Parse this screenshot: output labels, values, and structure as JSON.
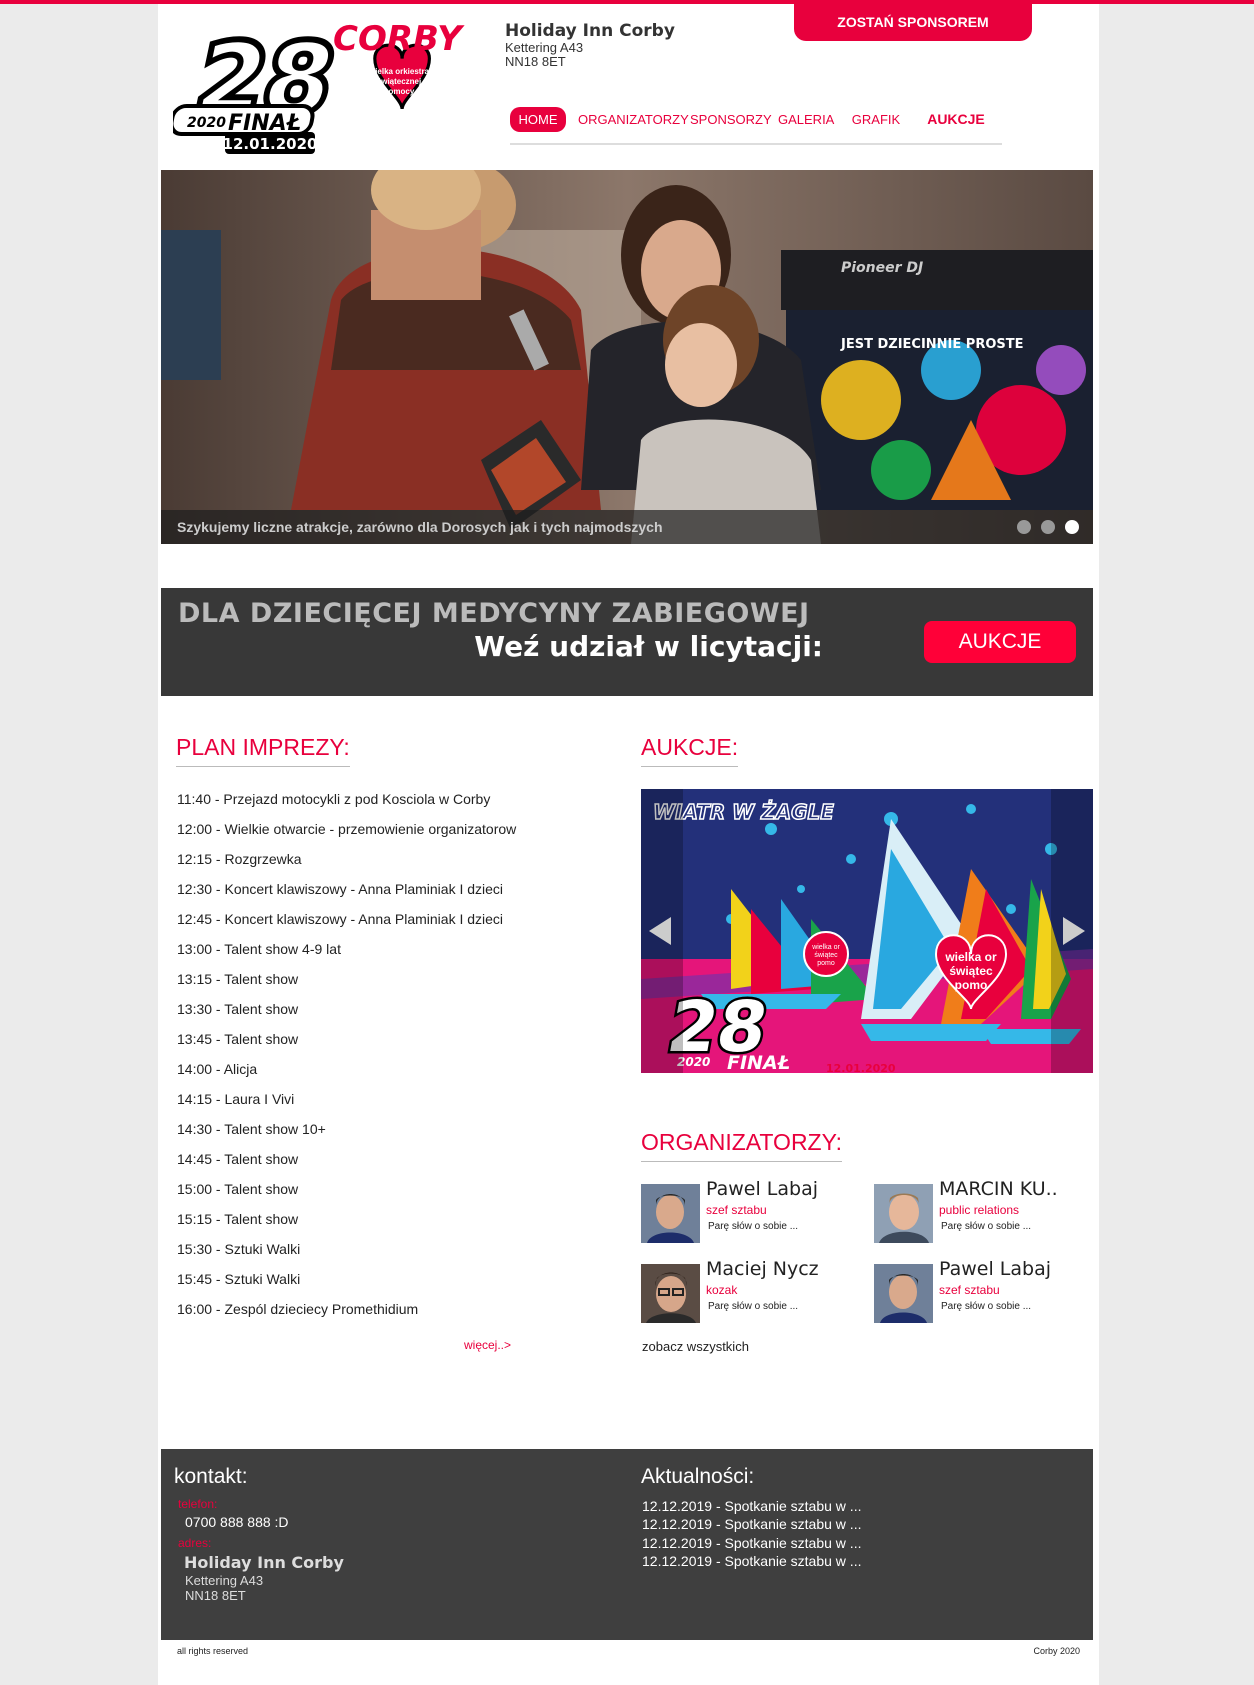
{
  "logo": {
    "number": "28",
    "city": "CORBY",
    "year": "2020",
    "final": "FINAŁ",
    "date": "12.01.2020",
    "heart_text": [
      "wielka orkiestra",
      "świątecznej",
      "pomocy"
    ]
  },
  "venue": {
    "name": "Holiday Inn Corby",
    "line1": "Kettering A43",
    "line2": "NN18 8ET"
  },
  "sponsor_button": "ZOSTAŃ SPONSOREM",
  "nav": {
    "home": "HOME",
    "organizers": "ORGANIZATORZY",
    "sponsors": "SPONSORZY",
    "gallery": "GALERIA",
    "schedule": "GRAFIK",
    "auctions": "AUKCJE"
  },
  "slider": {
    "caption": "Szykujemy liczne atrakcje, zarówno dla Dorosych jak i tych najmodszych",
    "dj_text": "Pioneer DJ",
    "sign_text": "JEST DZIECINNIE PROSTE",
    "active_slide": 3,
    "slide_count": 3
  },
  "banner": {
    "line1": "DLA DZIECIĘCEJ MEDYCYNY ZABIEGOWEJ",
    "line2": "Weź udział w licytacji:",
    "button": "AUKCJE"
  },
  "plan": {
    "title": "PLAN IMPREZY:",
    "items": [
      "11:40 - Przejazd motocykli z pod Kosciola w Corby",
      "12:00 - Wielkie otwarcie - przemowienie organizatorow",
      "12:15 - Rozgrzewka",
      "12:30 - Koncert klawiszowy - Anna Plaminiak I dzieci",
      "12:45 - Koncert klawiszowy - Anna Plaminiak I dzieci",
      "13:00 - Talent show 4-9 lat",
      "13:15 - Talent show",
      "13:30 - Talent show",
      "13:45 - Talent show",
      "14:00 - Alicja",
      "14:15 - Laura I Vivi",
      "14:30 - Talent show 10+",
      "14:45 - Talent show",
      "15:00 - Talent show",
      "15:15 - Talent show",
      "15:30 - Sztuki Walki",
      "15:45 - Sztuki Walki",
      "16:00 - Zespól dzieciecy Promethidium"
    ],
    "more": "więcej..>"
  },
  "auctions": {
    "title": "AUKCJE:",
    "image_title": "WIATR W ŻAGLE",
    "image_number": "28",
    "image_year": "2020",
    "image_final": "FINAŁ",
    "image_date": "12.01.2020",
    "image_heart": [
      "wielka or",
      "świątec",
      "pomo"
    ],
    "image_heart_small": [
      "wielka or",
      "świątec",
      "pomo"
    ]
  },
  "organizers": {
    "title": "ORGANIZATORZY:",
    "people": [
      {
        "name": "Pawel Labaj",
        "role": "szef sztabu",
        "desc": "Parę słów o sobie ..."
      },
      {
        "name": "MARCIN KU..",
        "role": "public relations",
        "desc": "Parę słów o sobie ..."
      },
      {
        "name": "Maciej Nycz",
        "role": "kozak",
        "desc": "Parę słów o sobie ..."
      },
      {
        "name": "Pawel Labaj",
        "role": "szef sztabu",
        "desc": "Parę słów o sobie ..."
      }
    ],
    "see_all": "zobacz wszystkich"
  },
  "footer": {
    "contact_title": "kontakt:",
    "phone_label": "telefon:",
    "phone": "0700 888 888 :D",
    "address_label": "adres:",
    "address_name": "Holiday Inn Corby",
    "address_line1": "Kettering A43",
    "address_line2": "NN18 8ET",
    "news_title": "Aktualności:",
    "news": [
      "12.12.2019 - Spotkanie sztabu w ...",
      "12.12.2019 - Spotkanie sztabu w ...",
      "12.12.2019 - Spotkanie sztabu w ...",
      "12.12.2019 - Spotkanie sztabu w ..."
    ],
    "rights": "all rights reserved",
    "copyright": "Corby 2020"
  },
  "colors": {
    "accent": "#e8003d",
    "dark": "#3f3f3f",
    "banner": "#383838"
  }
}
